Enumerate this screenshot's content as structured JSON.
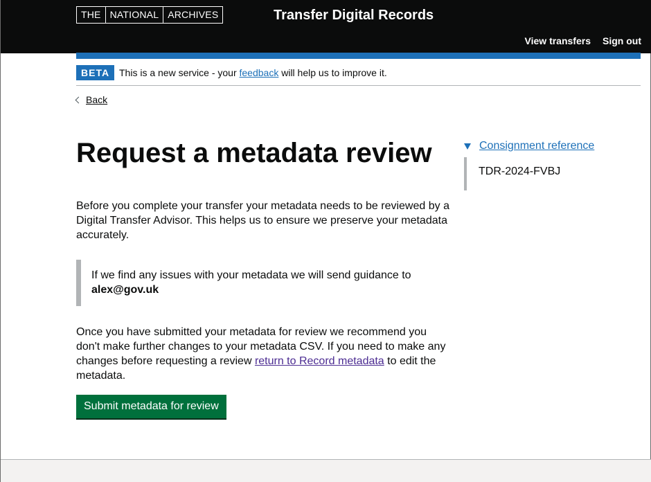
{
  "header": {
    "logo": [
      "THE",
      "NATIONAL",
      "ARCHIVES"
    ],
    "service_name": "Transfer Digital Records",
    "nav": [
      "View transfers",
      "Sign out"
    ]
  },
  "phase_banner": {
    "tag": "BETA",
    "text_before": "This is a new service - your ",
    "link": "feedback",
    "text_after": " will help us to improve it."
  },
  "back_link": "Back",
  "page_title": "Request a metadata review",
  "intro": "Before you complete your transfer your metadata needs to be reviewed by a Digital Transfer Advisor. This helps us to ensure we preserve your metadata accurately.",
  "inset": {
    "text": "If we find any issues with your metadata we will send guidance to",
    "email": "alex@gov.uk"
  },
  "paragraph2": {
    "text_before": "Once you have submitted your metadata for review we recommend you don't make further changes to your metadata CSV. If you need to make any changes before requesting a review ",
    "link": "return to Record metadata",
    "text_after": " to edit the metadata."
  },
  "submit_button": "Submit metadata for review",
  "consignment": {
    "summary": "Consignment reference",
    "value": "TDR-2024-FVBJ"
  },
  "colors": {
    "header_bg": "#0b0c0c",
    "brand_blue": "#1d70b8",
    "button_green": "#00703c",
    "visited_link": "#4c2c92"
  }
}
